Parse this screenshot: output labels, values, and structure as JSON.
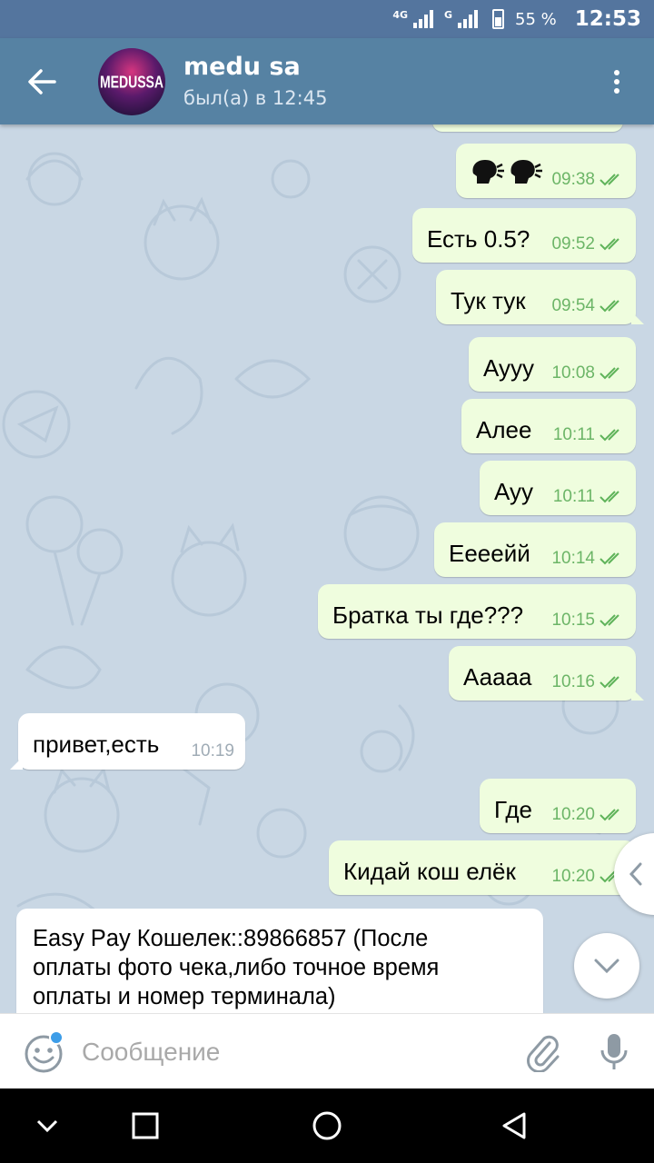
{
  "status_bar": {
    "network_1": "4G",
    "network_2": "G",
    "battery": "55 %",
    "time": "12:53"
  },
  "header": {
    "back_icon": "arrow-left-icon",
    "avatar_text": "MEDUSSA",
    "title": "medu sa",
    "status": "был(а) в 12:45",
    "menu_icon": "more-vertical-icon"
  },
  "messages": [
    {
      "dir": "out",
      "emoji": [
        "speaking-head",
        "speaking-head"
      ],
      "time": "09:38",
      "read": true
    },
    {
      "dir": "out",
      "text": "Есть 0.5?",
      "time": "09:52",
      "read": true
    },
    {
      "dir": "out",
      "text": "Тук тук",
      "time": "09:54",
      "read": true
    },
    {
      "dir": "out",
      "text": "Аууу",
      "time": "10:08",
      "read": true
    },
    {
      "dir": "out",
      "text": "Алее",
      "time": "10:11",
      "read": true
    },
    {
      "dir": "out",
      "text": "Ауу",
      "time": "10:11",
      "read": true
    },
    {
      "dir": "out",
      "text": "Еееейй",
      "time": "10:14",
      "read": true
    },
    {
      "dir": "out",
      "text": "Братка ты где???",
      "time": "10:15",
      "read": true
    },
    {
      "dir": "out",
      "text": "Ааааа",
      "time": "10:16",
      "read": true
    },
    {
      "dir": "in",
      "text": "привет,есть",
      "time": "10:19"
    },
    {
      "dir": "out",
      "text": "Где",
      "time": "10:20",
      "read": true
    },
    {
      "dir": "out",
      "text": "Кидай кош елёк",
      "time": "10:20",
      "read": true
    },
    {
      "dir": "in",
      "text_lines": [
        "Easy Pay Кошелек::89866857  (После",
        "оплаты фото чека,либо точное время",
        "оплаты и номер терминала)"
      ]
    }
  ],
  "input": {
    "placeholder": "Сообщение",
    "emoji_icon": "smile-icon",
    "attach_icon": "paperclip-icon",
    "mic_icon": "microphone-icon"
  },
  "nav": {
    "hide_icon": "chevron-down-icon",
    "recents_icon": "square-icon",
    "home_icon": "circle-icon",
    "back_icon": "triangle-back-icon"
  },
  "colors": {
    "status_bar": "#54759e",
    "header": "#5682a3",
    "chat_bg": "#c9d7e4",
    "bubble_out": "#effdde",
    "bubble_in": "#ffffff",
    "time_out": "#6cb567",
    "time_in": "#a0acb6"
  }
}
